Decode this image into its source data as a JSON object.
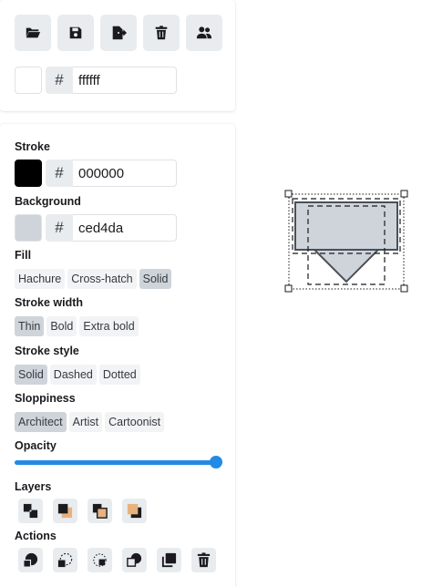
{
  "toolbar": {
    "buttons": [
      {
        "name": "open",
        "icon": "folder-open-icon"
      },
      {
        "name": "save",
        "icon": "save-icon"
      },
      {
        "name": "export",
        "icon": "export-icon"
      },
      {
        "name": "clear",
        "icon": "trash-icon"
      },
      {
        "name": "collaborate",
        "icon": "users-icon"
      }
    ]
  },
  "canvas_background": {
    "swatch": "#ffffff",
    "hash": "#",
    "value": "ffffff"
  },
  "stroke": {
    "label": "Stroke",
    "swatch": "#000000",
    "hash": "#",
    "value": "000000"
  },
  "background": {
    "label": "Background",
    "swatch": "#ced4da",
    "hash": "#",
    "value": "ced4da"
  },
  "fill": {
    "label": "Fill",
    "options": [
      "Hachure",
      "Cross-hatch",
      "Solid"
    ],
    "selected": "Solid"
  },
  "stroke_width": {
    "label": "Stroke width",
    "options": [
      "Thin",
      "Bold",
      "Extra bold"
    ],
    "selected": "Thin"
  },
  "stroke_style": {
    "label": "Stroke style",
    "options": [
      "Solid",
      "Dashed",
      "Dotted"
    ],
    "selected": "Solid"
  },
  "sloppiness": {
    "label": "Sloppiness",
    "options": [
      "Architect",
      "Artist",
      "Cartoonist"
    ],
    "selected": "Architect"
  },
  "opacity": {
    "label": "Opacity",
    "value_percent": 100
  },
  "layers": {
    "label": "Layers",
    "icons": [
      "send-to-back-icon",
      "send-backward-icon",
      "bring-forward-icon",
      "bring-to-front-icon"
    ]
  },
  "actions": {
    "label": "Actions",
    "icons": [
      "copy-styles-icon",
      "paste-styles-icon",
      "duplicate-icon",
      "group-icon",
      "copy-icon",
      "delete-icon"
    ]
  },
  "colors": {
    "accent": "#228be6",
    "button_bg": "#e9ecef",
    "active_bg": "#ced4da",
    "layer_orange": "#e8b27d"
  }
}
